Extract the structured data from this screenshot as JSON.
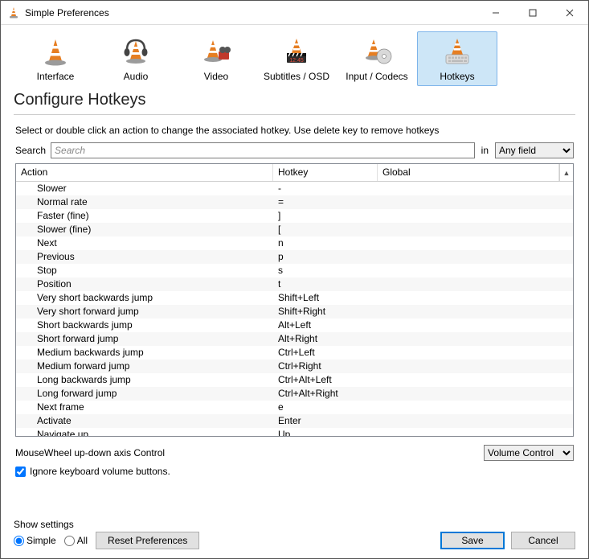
{
  "window": {
    "title": "Simple Preferences"
  },
  "tabs": [
    {
      "label": "Interface"
    },
    {
      "label": "Audio"
    },
    {
      "label": "Video"
    },
    {
      "label": "Subtitles / OSD"
    },
    {
      "label": "Input / Codecs"
    },
    {
      "label": "Hotkeys",
      "selected": true
    }
  ],
  "heading": "Configure Hotkeys",
  "instruction": "Select or double click an action to change the associated hotkey. Use delete key to remove hotkeys",
  "search": {
    "label": "Search",
    "placeholder": "Search",
    "in_label": "in",
    "field_options": [
      "Any field"
    ],
    "field_selected": "Any field"
  },
  "columns": {
    "action": "Action",
    "hotkey": "Hotkey",
    "global": "Global"
  },
  "rows": [
    {
      "action": "Slower",
      "hotkey": "-",
      "global": ""
    },
    {
      "action": "Normal rate",
      "hotkey": "=",
      "global": ""
    },
    {
      "action": "Faster (fine)",
      "hotkey": "]",
      "global": ""
    },
    {
      "action": "Slower (fine)",
      "hotkey": "[",
      "global": ""
    },
    {
      "action": "Next",
      "hotkey": "n",
      "global": ""
    },
    {
      "action": "Previous",
      "hotkey": "p",
      "global": ""
    },
    {
      "action": "Stop",
      "hotkey": "s",
      "global": ""
    },
    {
      "action": "Position",
      "hotkey": "t",
      "global": ""
    },
    {
      "action": "Very short backwards jump",
      "hotkey": "Shift+Left",
      "global": ""
    },
    {
      "action": "Very short forward jump",
      "hotkey": "Shift+Right",
      "global": ""
    },
    {
      "action": "Short backwards jump",
      "hotkey": "Alt+Left",
      "global": ""
    },
    {
      "action": "Short forward jump",
      "hotkey": "Alt+Right",
      "global": ""
    },
    {
      "action": "Medium backwards jump",
      "hotkey": "Ctrl+Left",
      "global": ""
    },
    {
      "action": "Medium forward jump",
      "hotkey": "Ctrl+Right",
      "global": ""
    },
    {
      "action": "Long backwards jump",
      "hotkey": "Ctrl+Alt+Left",
      "global": ""
    },
    {
      "action": "Long forward jump",
      "hotkey": "Ctrl+Alt+Right",
      "global": ""
    },
    {
      "action": "Next frame",
      "hotkey": "e",
      "global": ""
    },
    {
      "action": "Activate",
      "hotkey": "Enter",
      "global": ""
    },
    {
      "action": "Navigate up",
      "hotkey": "Up",
      "global": ""
    }
  ],
  "mousewheel": {
    "label": "MouseWheel up-down axis Control",
    "selected": "Volume Control"
  },
  "ignore_kb": {
    "label": "Ignore keyboard volume buttons.",
    "checked": true
  },
  "show_settings": {
    "label": "Show settings",
    "simple": "Simple",
    "all": "All",
    "selected": "simple"
  },
  "buttons": {
    "reset": "Reset Preferences",
    "save": "Save",
    "cancel": "Cancel"
  }
}
